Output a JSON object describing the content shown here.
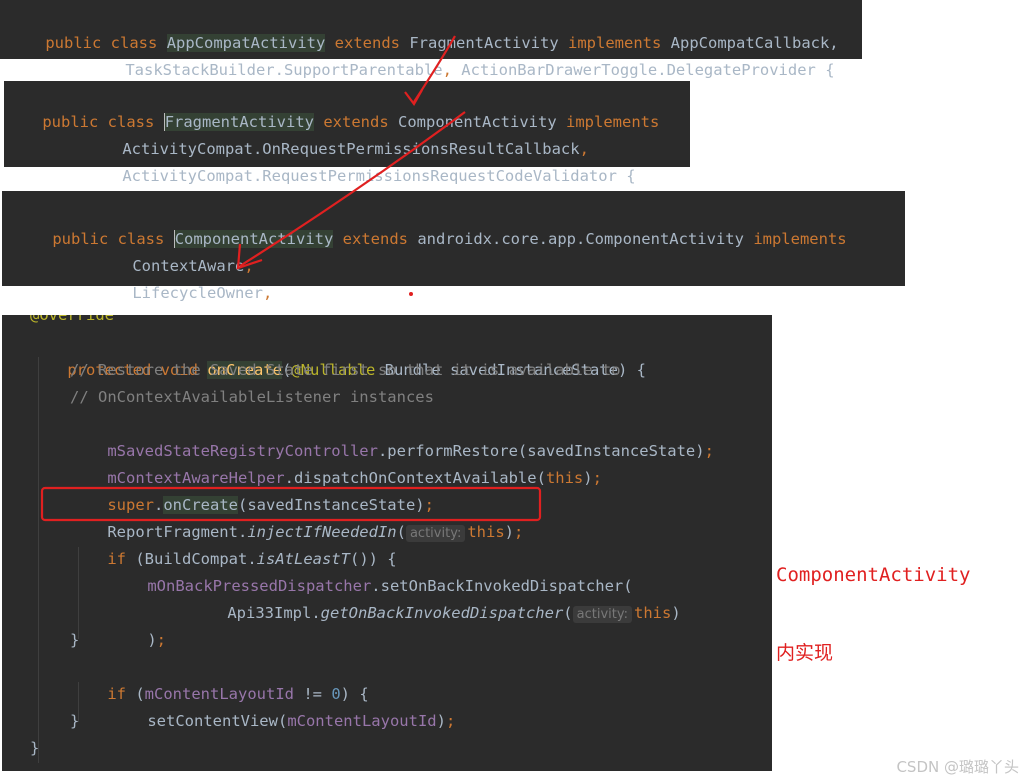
{
  "snippet1": {
    "line1": {
      "kw1": "public",
      "kw2": "class",
      "name": "AppCompatActivity",
      "kw3": "extends",
      "parent": "FragmentActivity",
      "kw4": "implements",
      "iface": "AppCompatCallback,"
    },
    "line2": {
      "a": "TaskStackBuilder.SupportParentable",
      "b": ", ",
      "c": "ActionBarDrawerToggle.DelegateProvider {"
    }
  },
  "snippet2": {
    "line1": {
      "kw1": "public",
      "kw2": "class",
      "name": "FragmentActivity",
      "kw3": "extends",
      "parent": "ComponentActivity",
      "kw4": "implements"
    },
    "line2": {
      "text": "ActivityCompat.OnRequestPermissionsResultCallback",
      "comma": ","
    },
    "line3": {
      "text": "ActivityCompat.RequestPermissionsRequestCodeValidator {"
    }
  },
  "snippet3": {
    "line1": {
      "kw1": "public",
      "kw2": "class",
      "name": "ComponentActivity",
      "kw3": "extends",
      "parent": "androidx.core.app.ComponentActivity",
      "kw4": "implements"
    },
    "line2": {
      "text": "ContextAware",
      "comma": ","
    },
    "line3": {
      "text": "LifecycleOwner",
      "comma": ","
    }
  },
  "snippet4": {
    "l0": "@Override",
    "l1": {
      "kw": "protected void",
      "fn": "onCreate",
      "open": "(",
      "ann": "@Nullable",
      "rest": " Bundle savedInstanceState) {"
    },
    "l2": "// Restore the Saved State first so that it is available to",
    "l3": "// OnContextAvailableListener instances",
    "l4": {
      "fld": "mSavedStateRegistryController",
      "rest": ".performRestore(savedInstanceState)",
      "semi": ";"
    },
    "l5": {
      "fld": "mContextAwareHelper",
      "rest": ".dispatchOnContextAvailable(",
      "kw": "this",
      "close": ")",
      "semi": ";"
    },
    "l6": {
      "kw": "super",
      "dot": ".",
      "fn": "onCreate",
      "rest": "(savedInstanceState)",
      "semi": ";"
    },
    "l7": {
      "cls": "ReportFragment.",
      "method": "injectIfNeededIn",
      "open": "(",
      "hint": "activity:",
      "kw": "this",
      "close": ")",
      "semi": ";"
    },
    "l8": {
      "kw": "if",
      "a": " (BuildCompat.",
      "method": "isAtLeastT",
      "b": "()) {"
    },
    "l9": {
      "fld": "mOnBackPressedDispatcher",
      "rest": ".setOnBackInvokedDispatcher("
    },
    "l10": {
      "cls": "Api33Impl.",
      "method": "getOnBackInvokedDispatcher",
      "open": "(",
      "hint": "activity:",
      "kw": "this",
      "close": ")"
    },
    "l11": {
      "close": ")",
      "semi": ";"
    },
    "l12": "}",
    "l13": {
      "kw": "if",
      "a": " (",
      "fld": "mContentLayoutId",
      "b": " != ",
      "num": "0",
      "c": ") {"
    },
    "l14": {
      "a": "setContentView(",
      "fld": "mContentLayoutId",
      "b": ")",
      "semi": ";"
    },
    "l15": "}",
    "l16": "}"
  },
  "annotation": {
    "line1": "ComponentActivity",
    "line2": "内实现"
  },
  "watermark": "CSDN @璐璐丫头",
  "colors": {
    "annotation_red": "#e02020",
    "editor_bg": "#2b2b2b",
    "keyword": "#cc7832",
    "field": "#9876aa",
    "method": "#ffc66d"
  }
}
